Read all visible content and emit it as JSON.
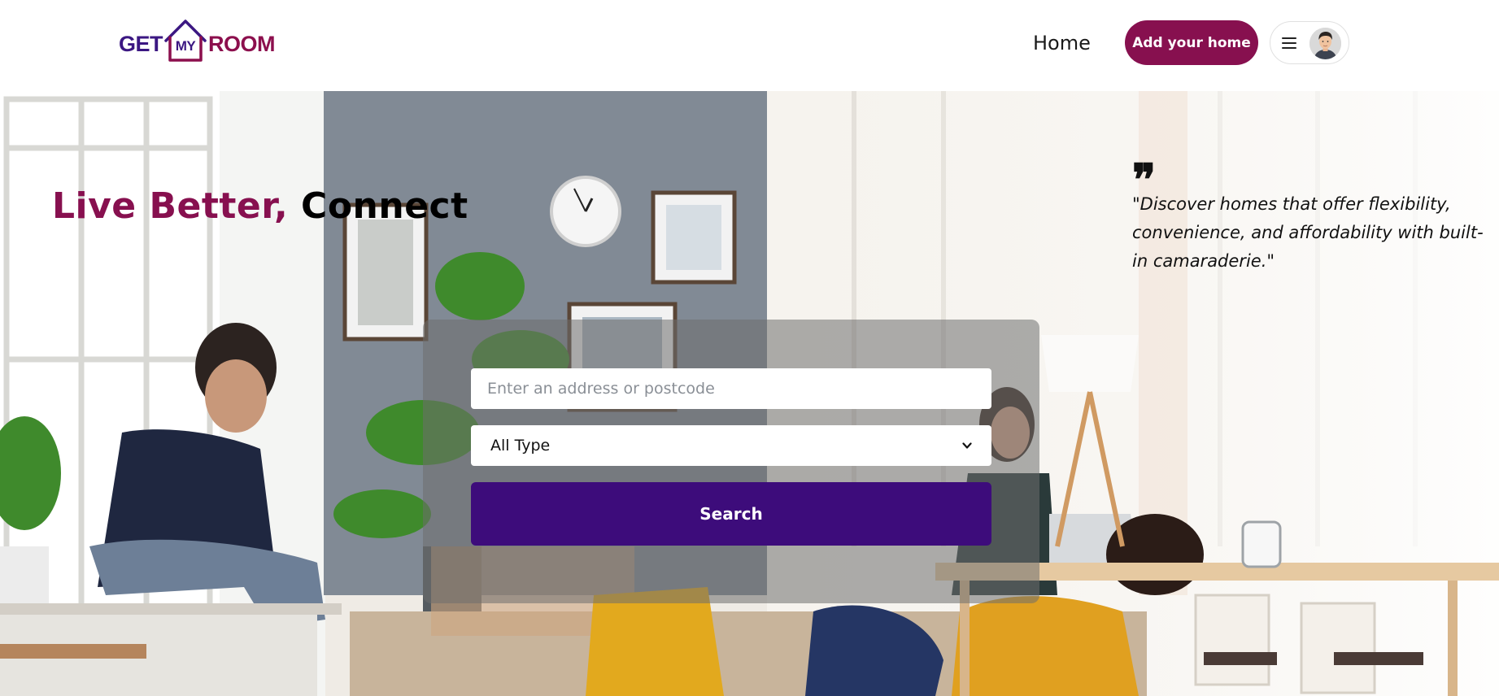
{
  "header": {
    "logo": {
      "left": "GET",
      "middle": "MY",
      "right": "ROOM"
    },
    "nav_home": "Home",
    "add_home_button": "Add your home"
  },
  "hero": {
    "headline_accent": "Live Better,",
    "headline_rest": "Connect",
    "quote_mark": "❞",
    "quote": "\"Discover homes that offer flexibility, convenience, and affordability with built-in camaraderie.\""
  },
  "search": {
    "placeholder": "Enter an address or postcode",
    "type_selected": "All Type",
    "button": "Search"
  },
  "colors": {
    "brand_primary": "#87104f",
    "brand_secondary": "#3d0c7b"
  },
  "icons": {
    "menu": "hamburger-icon",
    "avatar": "user-avatar",
    "select": "chevron-down-icon",
    "quote": "quote-icon"
  }
}
